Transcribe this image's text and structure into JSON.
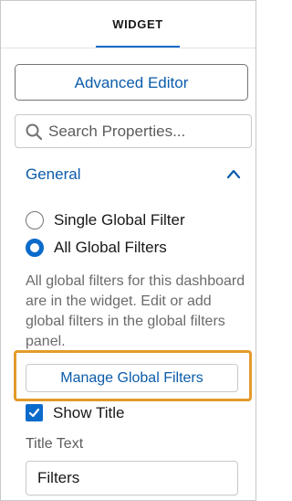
{
  "tabs": [
    {
      "label": "WIDGET",
      "active": true
    }
  ],
  "advanced_editor_label": "Advanced Editor",
  "search": {
    "placeholder": "Search Properties...",
    "value": ""
  },
  "section": {
    "title": "General",
    "expanded": true
  },
  "filter_mode": {
    "options": [
      {
        "label": "Single Global Filter",
        "selected": false
      },
      {
        "label": "All Global Filters",
        "selected": true
      }
    ],
    "help_text": "All global filters for this dashboard are in the widget. Edit or add global filters in the global filters panel.",
    "manage_button_label": "Manage Global Filters"
  },
  "show_title": {
    "label": "Show Title",
    "checked": true
  },
  "title_text": {
    "label": "Title Text",
    "value": "Filters"
  },
  "colors": {
    "accent": "#0b6bcb",
    "link": "#0b5cab",
    "highlight": "#e39b2a",
    "border": "#c9c9c9"
  },
  "icons": {
    "search": "search-icon",
    "collapse": "chevron-up-icon",
    "check": "checkmark-icon"
  }
}
